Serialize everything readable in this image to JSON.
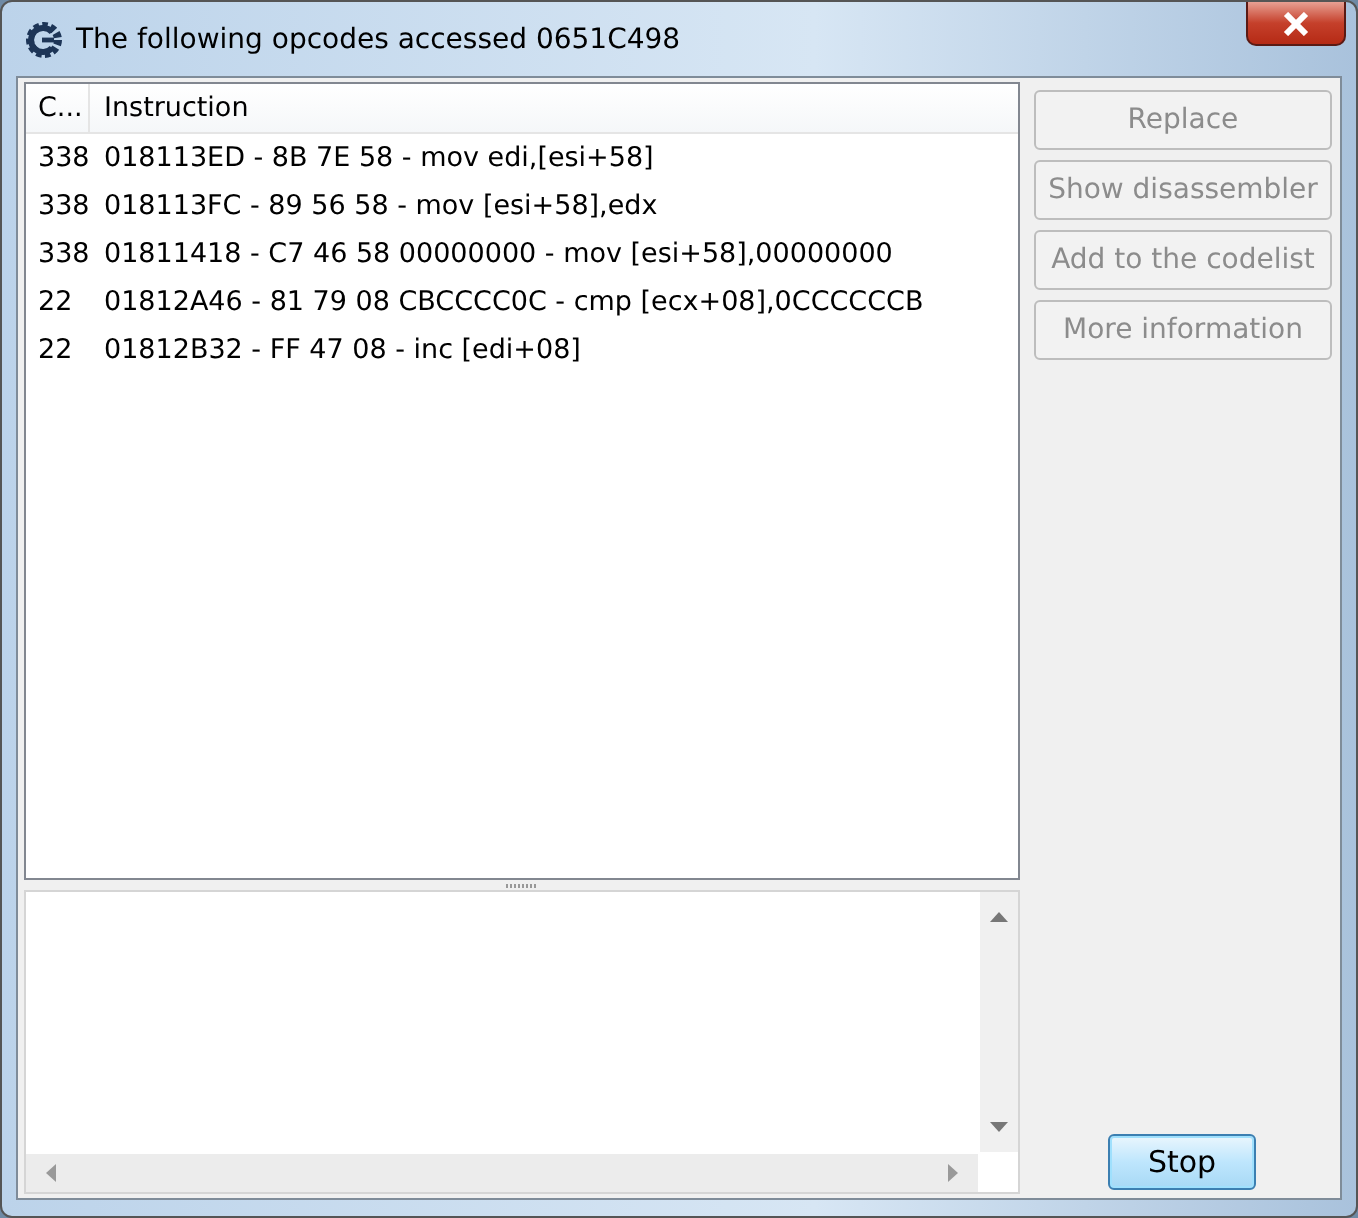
{
  "window": {
    "title": "The following opcodes accessed 0651C498"
  },
  "table": {
    "columns": [
      "C...",
      "Instruction"
    ],
    "rows": [
      {
        "count": "338",
        "instruction": "018113ED - 8B 7E 58  - mov edi,[esi+58]"
      },
      {
        "count": "338",
        "instruction": "018113FC - 89 56 58  - mov [esi+58],edx"
      },
      {
        "count": "338",
        "instruction": "01811418 - C7 46 58 00000000 - mov [esi+58],00000000"
      },
      {
        "count": "22",
        "instruction": "01812A46 - 81 79 08 CBCCCC0C - cmp [ecx+08],0CCCCCCB"
      },
      {
        "count": "22",
        "instruction": "01812B32 - FF 47 08  - inc [edi+08]"
      }
    ]
  },
  "buttons": [
    {
      "label": "Replace",
      "disabled": true
    },
    {
      "label": "Show disassembler",
      "disabled": true
    },
    {
      "label": "Add to the codelist",
      "disabled": true
    },
    {
      "label": "More information",
      "disabled": true
    }
  ],
  "stop_button": {
    "label": "Stop"
  }
}
